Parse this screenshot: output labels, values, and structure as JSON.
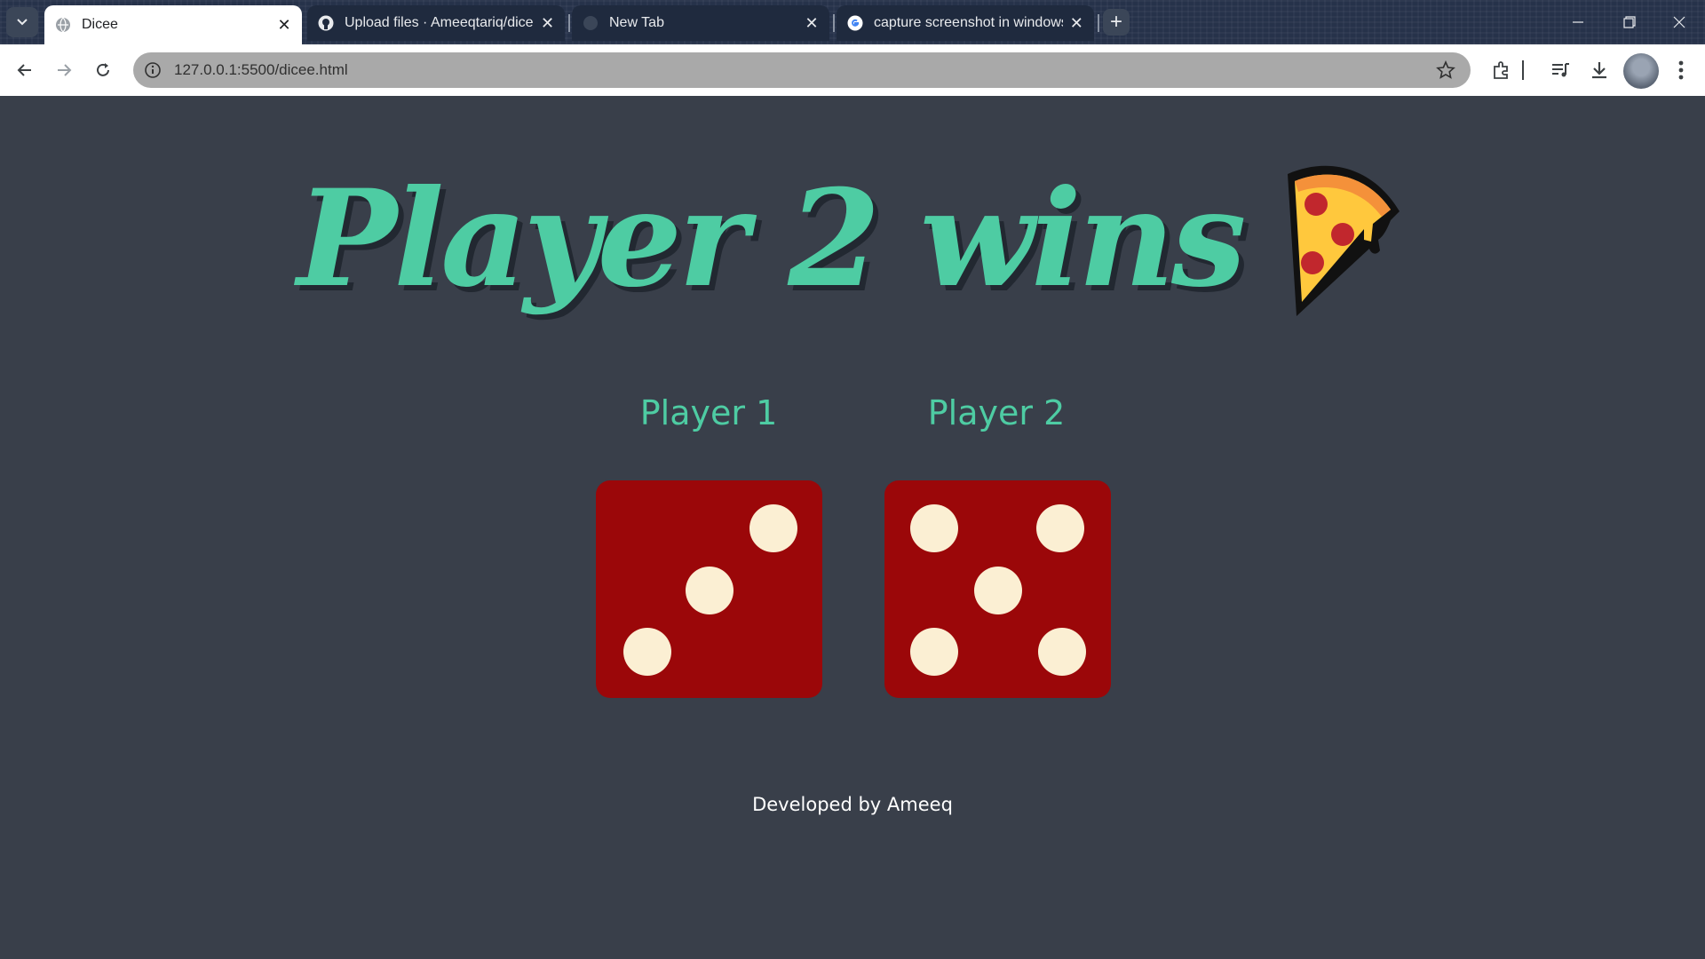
{
  "browser": {
    "tabs": [
      {
        "title": "Dicee",
        "active": true,
        "icon": "globe-icon"
      },
      {
        "title": "Upload files · Ameeqtariq/diceG",
        "active": false,
        "icon": "github-icon"
      },
      {
        "title": "New Tab",
        "active": false,
        "icon": "newtab-icon"
      },
      {
        "title": "capture screenshot in windows",
        "active": false,
        "icon": "google-icon"
      }
    ],
    "new_tab_label": "+",
    "url": "127.0.0.1:5500/dicee.html"
  },
  "page": {
    "headline": "Player 2 wins",
    "players": [
      {
        "label": "Player 1",
        "die_value": 3
      },
      {
        "label": "Player 2",
        "die_value": 5
      }
    ],
    "footer": "Developed by Ameeq"
  },
  "colors": {
    "background": "#393f4a",
    "accent": "#4ecca3",
    "die": "#9b0709",
    "pip": "#fbefd3"
  }
}
